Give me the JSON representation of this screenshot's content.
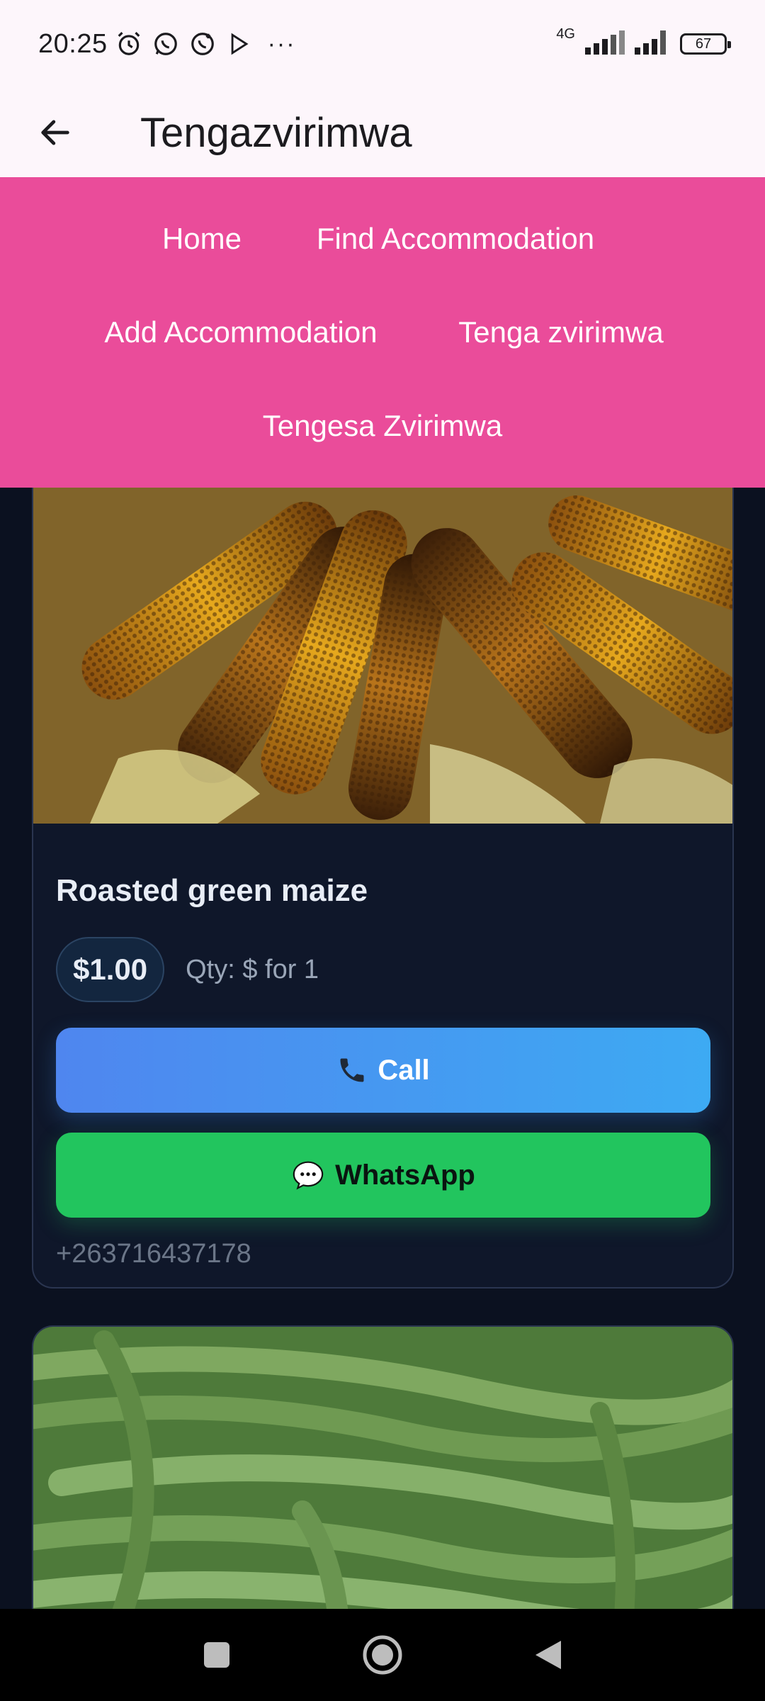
{
  "status": {
    "time": "20:25",
    "network": "4G",
    "battery": "67",
    "overflow": "···"
  },
  "app_bar": {
    "title": "Tengazvirimwa",
    "back_icon": "arrow-back-icon"
  },
  "nav": {
    "items": [
      {
        "label": "Home"
      },
      {
        "label": "Find Accommodation"
      },
      {
        "label": "Add Accommodation"
      },
      {
        "label": "Tenga zvirimwa"
      },
      {
        "label": "Tengesa Zvirimwa"
      }
    ],
    "background": "#ea4c9a"
  },
  "listings": [
    {
      "title": "Roasted green maize",
      "price": "$1.00",
      "qty": "Qty: $ for 1",
      "call_label": "Call",
      "call_icon": "phone-icon",
      "whatsapp_label": "WhatsApp",
      "whatsapp_icon": "speech-bubble-icon",
      "phone": "+263716437178"
    },
    {
      "title": "",
      "image": "green-beans"
    }
  ],
  "colors": {
    "call_button": "#4f86ef",
    "whatsapp_button": "#22c55e",
    "card_background": "#0f172a",
    "page_background": "#0b1120"
  }
}
